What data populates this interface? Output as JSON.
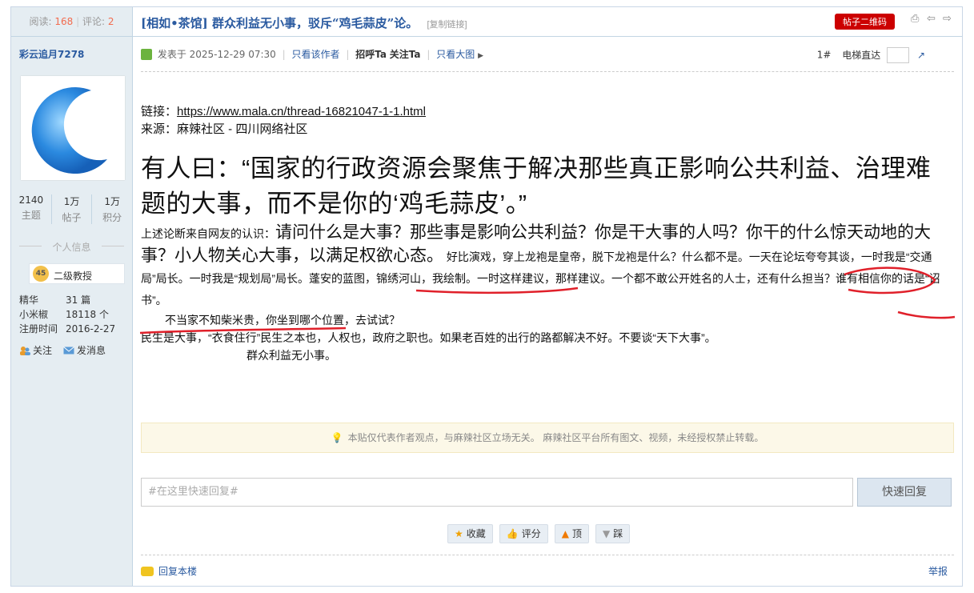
{
  "sidebar": {
    "views_label": "阅读:",
    "views": "168",
    "replies_label": "评论:",
    "replies": "2",
    "author": "彩云追月7278",
    "stats": [
      {
        "value": "2140",
        "label": "主题"
      },
      {
        "value": "1万",
        "label": "帖子"
      },
      {
        "value": "1万",
        "label": "积分"
      }
    ],
    "section_title": "个人信息",
    "rank_level": "45",
    "rank_title": "二级教授",
    "info": [
      {
        "key": "精华",
        "value": "31 篇"
      },
      {
        "key": "小米椒",
        "value": "18118 个"
      },
      {
        "key": "注册时间",
        "value": "2016-2-27"
      }
    ],
    "follow": "关注",
    "message": "发消息"
  },
  "header": {
    "title": "[相如•茶馆] 群众利益无小事，驳斥“鸡毛蒜皮”论。",
    "copy_link": "[复制链接]",
    "qr_button": "帖子二维码"
  },
  "post_meta": {
    "posted": "发表于 2025-12-29 07:30",
    "only_author": "只看该作者",
    "greet": "招呼Ta",
    "follow": "关注Ta",
    "big_image": "只看大图",
    "floor": "1#",
    "elevator": "电梯直达"
  },
  "content": {
    "link_label": "链接：",
    "link_url": "https://www.mala.cn/thread-16821047-1-1.html",
    "source": "来源：麻辣社区 - 四川网络社区",
    "headline": "有人曰：“国家的行政资源会聚焦于解决那些真正影响公共利益、治理难题的大事，而不是你的‘鸡毛蒜皮’。”",
    "p1_small": "上述论断来自网友的认识：",
    "p1_big": "请问什么是大事？那些事是影响公共利益？你是干大事的人吗？你干的什么惊天动地的大事？小人物关心大事，以满足权欲心态。",
    "p1_rest": "好比演戏，穿上龙袍是皇帝，脱下龙袍是什么？什么都不是。一天在论坛夸夸其谈，一时我是“交通局”局长。一时我是“规划局”局长。蓬安的蓝图，锦绣河山，我绘制。一时这样建议，那样建议。一个都不敢公开姓名的人士，还有什么担当？谁有相信你的话是“诏书”。",
    "line2": "不当家不知柴米贵，你坐到哪个位置，去试试？",
    "line3": "民生是大事，“衣食住行”民生之本也，人权也，政府之职也。如果老百姓的出行的路都解决不好。不要谈“天下大事”。",
    "line4": "群众利益无小事。"
  },
  "notice": "本贴仅代表作者观点，与麻辣社区立场无关。 麻辣社区平台所有图文、视频，未经授权禁止转载。",
  "reply": {
    "placeholder": "#在这里快速回复#",
    "button": "快速回复"
  },
  "buttons": {
    "collect": "收藏",
    "rate": "评分",
    "up": "顶",
    "down": "踩"
  },
  "footer": {
    "reply_floor": "回复本楼",
    "report": "举报"
  },
  "colors": {
    "link": "#2a5aa0",
    "accent_red": "#cc0000",
    "sidebar_bg": "#e5edf2",
    "annotation_red": "#e0202a"
  }
}
